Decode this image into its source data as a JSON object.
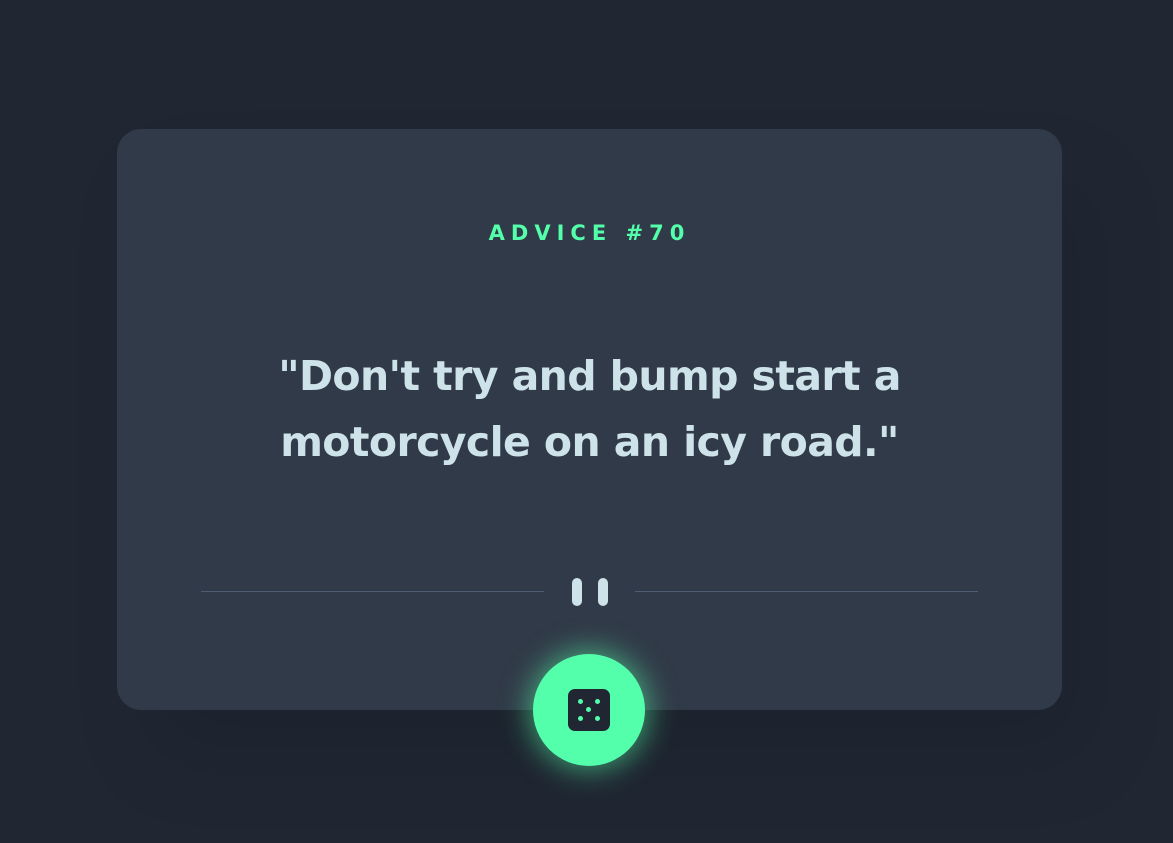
{
  "advice": {
    "heading": "ADVICE #70",
    "text": "\"Don't try and bump start a motorcycle on an icy road.\""
  },
  "icons": {
    "divider": "pause-divider-icon",
    "dice": "dice-five-icon"
  },
  "colors": {
    "background": "#202733",
    "card": "#313a48",
    "accent": "#53ffaa",
    "text": "#cee3e9",
    "divider": "#4f5d74"
  }
}
